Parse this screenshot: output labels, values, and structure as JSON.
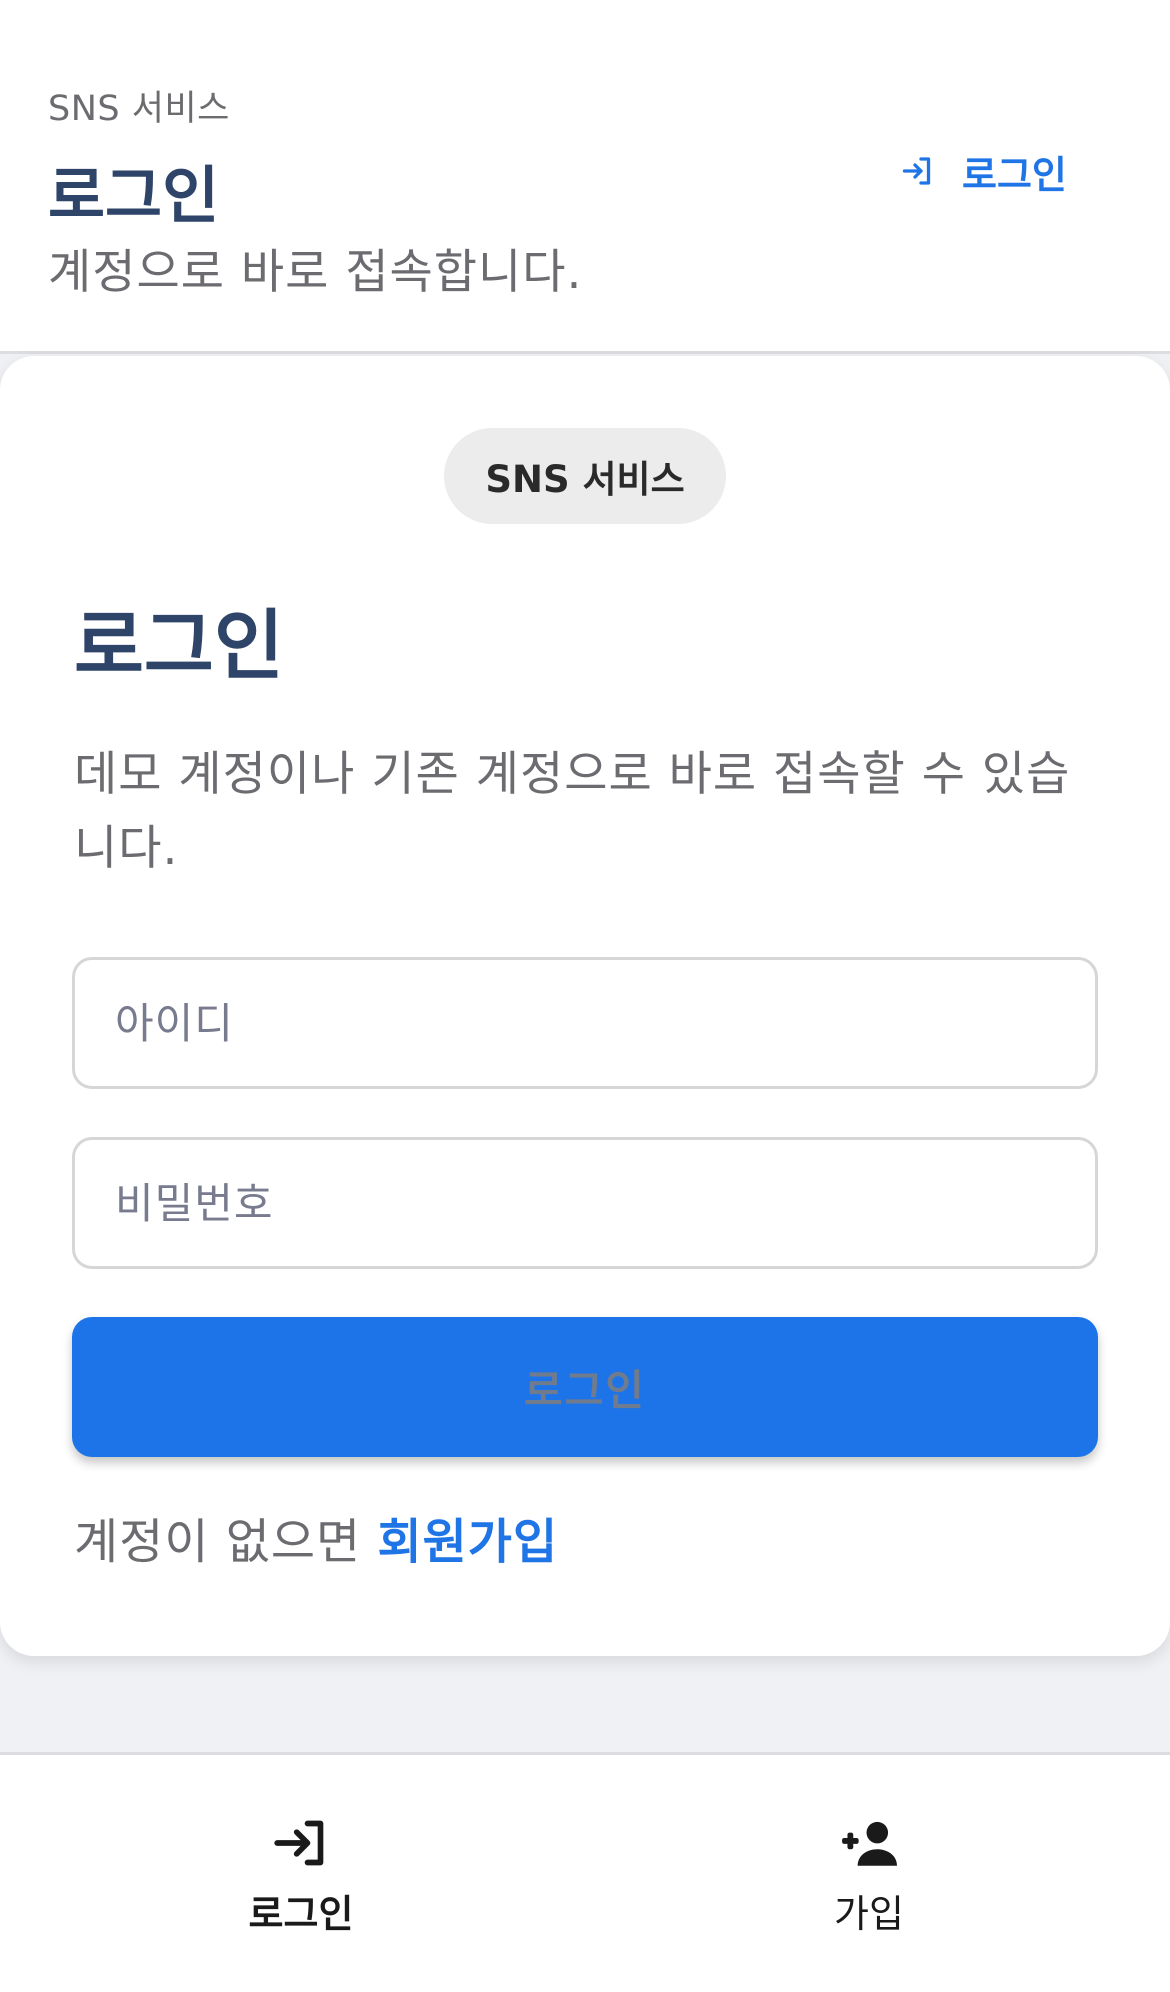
{
  "header": {
    "eyebrow": "SNS 서비스",
    "title": "로그인",
    "subtitle": "계정으로 바로 접속합니다.",
    "login_link": "로그인",
    "login_icon": "login-icon"
  },
  "card": {
    "badge": "SNS 서비스",
    "title": "로그인",
    "description": "데모 계정이나 기존 계정으로 바로 접속할 수 있습니다.",
    "username": {
      "value": "",
      "placeholder": "아이디"
    },
    "password": {
      "value": "",
      "placeholder": "비밀번호"
    },
    "submit_label": "로그인",
    "signup_prompt": "계정이 없으면",
    "signup_link": "회원가입"
  },
  "bottom_nav": {
    "items": [
      {
        "label": "로그인",
        "icon": "login-icon",
        "active": true
      },
      {
        "label": "가입",
        "icon": "person-add-icon",
        "active": false
      }
    ]
  },
  "colors": {
    "accent": "#1f74e6",
    "button": "#1c74e8",
    "title": "#2e4468",
    "muted_text": "#6b6b70",
    "background": "#f0f1f5"
  }
}
